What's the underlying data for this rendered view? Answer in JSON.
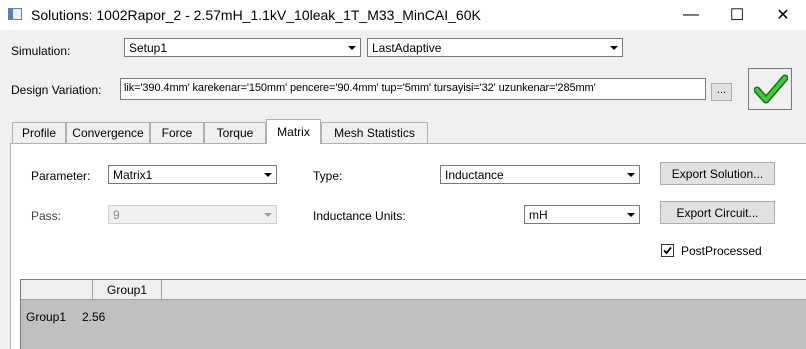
{
  "window": {
    "title": "Solutions: 1002Rapor_2 - 2.57mH_1.1kV_10leak_1T_M33_MinCAI_60K",
    "minimize_glyph": "—",
    "maximize_glyph": "☐",
    "close_glyph": "✕"
  },
  "simulation": {
    "label": "Simulation:",
    "setup_value": "Setup1",
    "solution_value": "LastAdaptive"
  },
  "design_variation": {
    "label": "Design Variation:",
    "value": "lik='390.4mm' karekenar='150mm' pencere='90.4mm' tup='5mm' tursayisi='32' uzunkenar='285mm'",
    "browse_label": "...",
    "status_icon": "checkmark-icon",
    "status_color": "#2fc12f"
  },
  "tabs": [
    {
      "label": "Profile"
    },
    {
      "label": "Convergence"
    },
    {
      "label": "Force"
    },
    {
      "label": "Torque"
    },
    {
      "label": "Matrix"
    },
    {
      "label": "Mesh Statistics"
    }
  ],
  "active_tab": "Matrix",
  "matrix": {
    "parameter_label": "Parameter:",
    "parameter_value": "Matrix1",
    "pass_label": "Pass:",
    "pass_value": "9",
    "type_label": "Type:",
    "type_value": "Inductance",
    "units_label": "Inductance Units:",
    "units_value": "mH",
    "export_solution_label": "Export Solution...",
    "export_circuit_label": "Export Circuit...",
    "postprocessed_label": "PostProcessed",
    "postprocessed_checked": true
  },
  "grid": {
    "columns": [
      "Group1"
    ],
    "rows": [
      {
        "header": "Group1",
        "values": [
          "2.56"
        ]
      }
    ]
  }
}
